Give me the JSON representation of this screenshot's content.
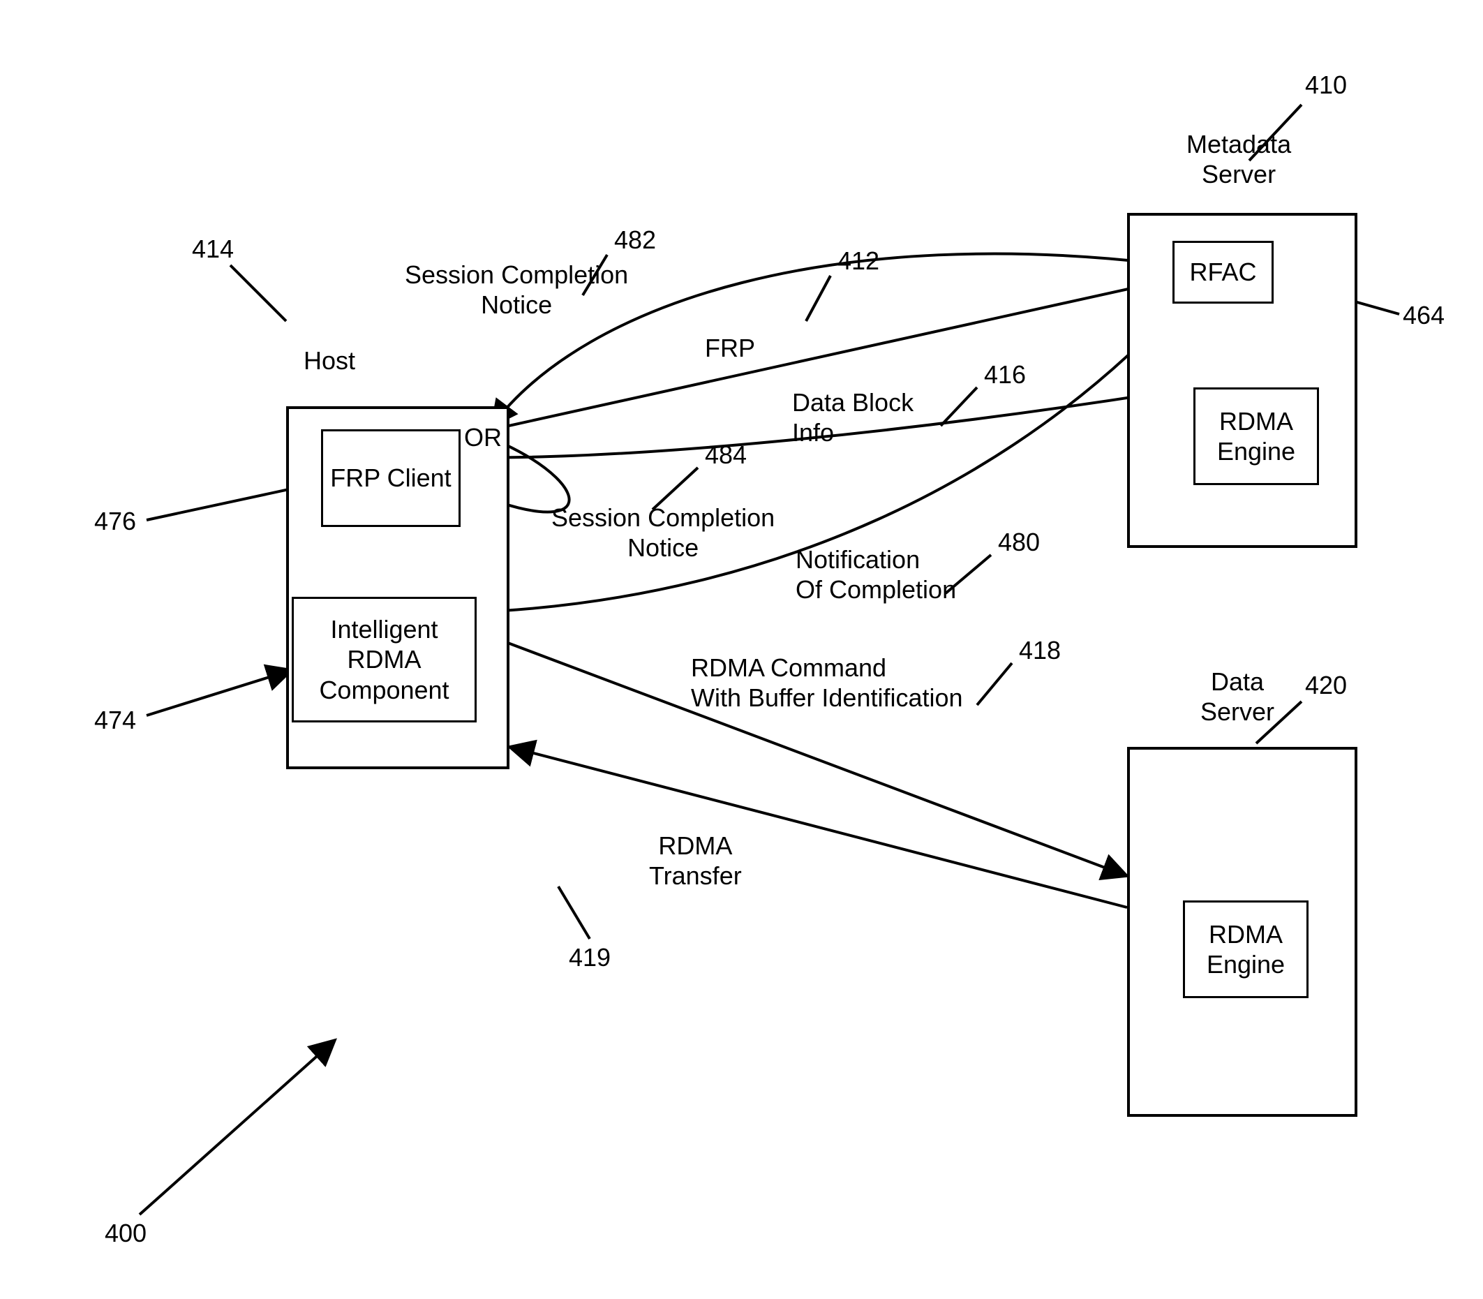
{
  "refs": {
    "r400": "400",
    "r410": "410",
    "r412": "412",
    "r414": "414",
    "r416": "416",
    "r418": "418",
    "r419": "419",
    "r420": "420",
    "r464": "464",
    "r474": "474",
    "r476": "476",
    "r480": "480",
    "r482": "482",
    "r484": "484"
  },
  "entities": {
    "host": "Host",
    "metadata_server": "Metadata\nServer",
    "data_server": "Data\nServer",
    "frp_client": "FRP\nClient",
    "intelligent_rdma": "Intelligent\nRDMA\nComponent",
    "rfac": "RFAC",
    "rdma_engine_meta": "RDMA\nEngine",
    "rdma_engine_data": "RDMA\nEngine",
    "or_text": "OR"
  },
  "labels": {
    "session_completion_482": "Session Completion\nNotice",
    "frp": "FRP",
    "data_block_info": "Data Block\nInfo",
    "session_completion_484": "Session Completion\nNotice",
    "notification_completion": "Notification\nOf Completion",
    "rdma_command": "RDMA Command\nWith Buffer Identification",
    "rdma_transfer": "RDMA\nTransfer"
  }
}
